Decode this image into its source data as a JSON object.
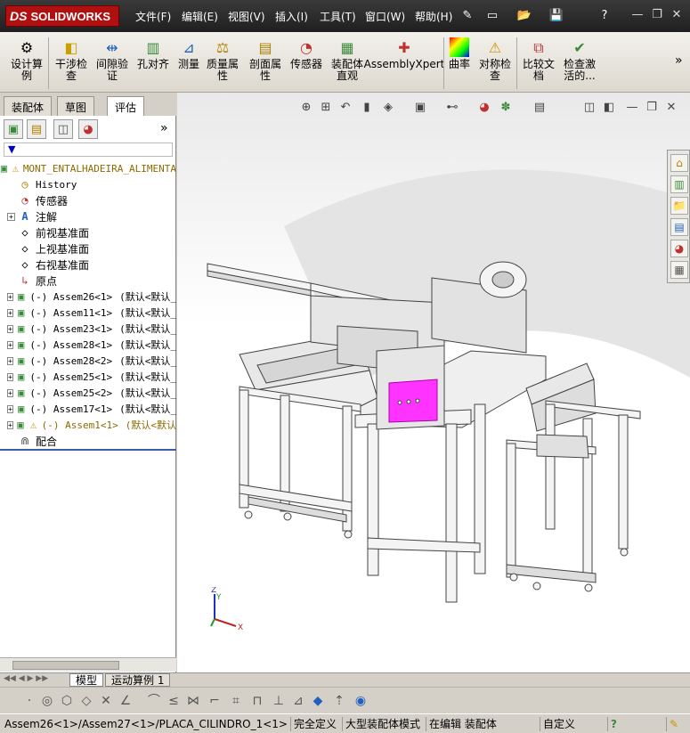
{
  "app": {
    "logo_brand": "SOLIDWORKS",
    "logo_ds": "DS"
  },
  "menu": {
    "items": [
      {
        "label": "文件(F)"
      },
      {
        "label": "编辑(E)"
      },
      {
        "label": "视图(V)"
      },
      {
        "label": "插入(I)"
      },
      {
        "label": "工具(T)"
      },
      {
        "label": "窗口(W)"
      },
      {
        "label": "帮助(H)"
      }
    ]
  },
  "commands": {
    "design_study": "设计算例",
    "interference": "干涉检查",
    "clearance": "间隙验证",
    "hole_align": "孔对齐",
    "measure": "测量",
    "mass_props": "质量属性",
    "section_props": "剖面属性",
    "sensor": "传感器",
    "assembly_visual": "装配体直观",
    "assemblyxpert": "AssemblyXpert",
    "curvature": "曲率",
    "symmetry": "对称检查",
    "compare": "比较文档",
    "check_active": "检查激活的..."
  },
  "tabs": [
    {
      "label": "装配体"
    },
    {
      "label": "草图"
    },
    {
      "label": "评估"
    }
  ],
  "tree": {
    "root": "MONT_ENTALHADEIRA_ALIMENTA",
    "history": "History",
    "sensors": "传感器",
    "annotations": "注解",
    "front_plane": "前视基准面",
    "top_plane": "上视基准面",
    "right_plane": "右视基准面",
    "origin": "原点",
    "components": [
      {
        "name": "(-) Assem26<1>",
        "config": "(默认<默认_"
      },
      {
        "name": "(-) Assem11<1>",
        "config": "(默认<默认_"
      },
      {
        "name": "(-) Assem23<1>",
        "config": "(默认<默认_"
      },
      {
        "name": "(-) Assem28<1>",
        "config": "(默认<默认_"
      },
      {
        "name": "(-) Assem28<2>",
        "config": "(默认<默认_"
      },
      {
        "name": "(-) Assem25<1>",
        "config": "(默认<默认_"
      },
      {
        "name": "(-) Assem25<2>",
        "config": "(默认<默认_"
      },
      {
        "name": "(-) Assem17<1>",
        "config": "(默认<默认_"
      },
      {
        "name": "(-) Assem1<1>",
        "config": "(默认<默认"
      }
    ],
    "mates": "配合"
  },
  "bottom_tabs": {
    "model": "模型",
    "motion": "运动算例 1"
  },
  "status": {
    "path": "Assem26<1>/Assem27<1>/PLACA_CILINDRO_1<1>",
    "defined": "完全定义",
    "large_mode": "大型装配体模式",
    "editing": "在编辑 装配体",
    "custom": "自定义"
  },
  "colors": {
    "logo_red": "#b01010",
    "highlight_magenta": "#ff33ff"
  },
  "triad": {
    "x": "X",
    "y": "Y",
    "z": "Z"
  }
}
